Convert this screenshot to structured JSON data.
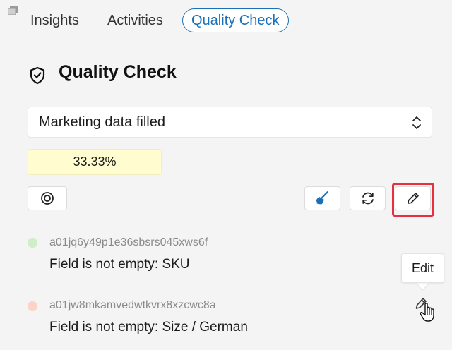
{
  "tabs": {
    "insights": "Insights",
    "activities": "Activities",
    "quality_check": "Quality Check"
  },
  "page_title": "Quality Check",
  "rule_select": {
    "selected": "Marketing data filled"
  },
  "progress": {
    "label": "33.33%",
    "value": 0.3333,
    "color": "#fffdd0"
  },
  "toolbar": {
    "icons": [
      "target-icon",
      "broom-icon",
      "refresh-icon",
      "pencil-icon"
    ],
    "highlight_color": "#e53040"
  },
  "results": [
    {
      "id": "a01jq6y49p1e36sbsrs045xws6f",
      "message": "Field is not empty: SKU",
      "status": "pass",
      "status_color": "#cdeec6"
    },
    {
      "id": "a01jw8mkamvedwtkvrx8xzcwc8a",
      "message": "Field is not empty: Size / German",
      "status": "fail",
      "status_color": "#fbd3c9"
    }
  ],
  "tooltip": {
    "text": "Edit"
  },
  "colors": {
    "accent": "#1b6fb8",
    "background": "#f4f4f4"
  }
}
